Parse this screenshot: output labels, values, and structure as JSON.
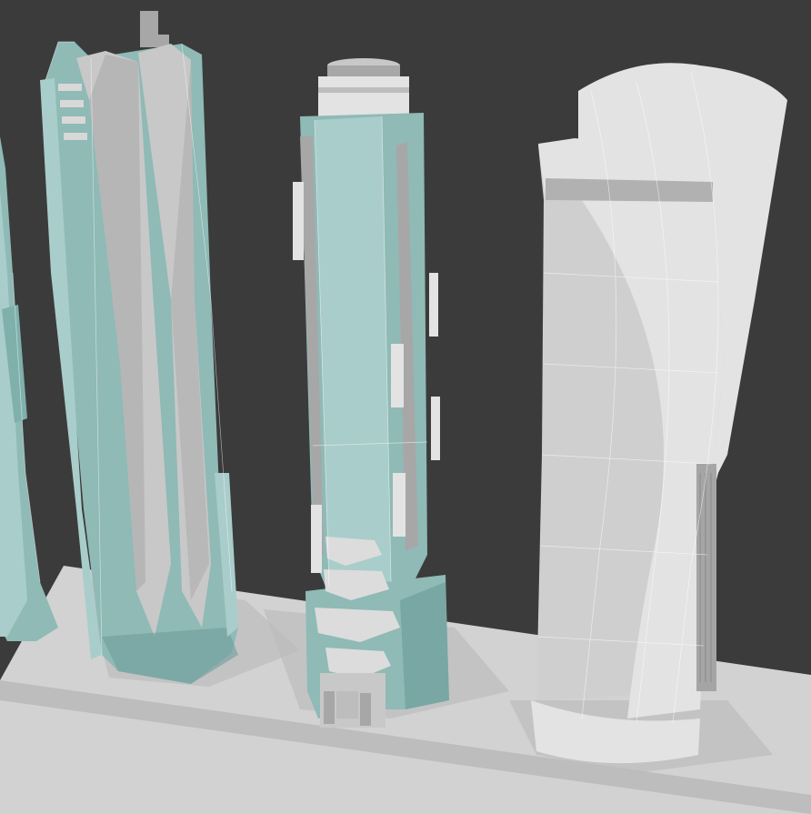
{
  "scene": {
    "background_color": "#3b3b3b",
    "floor_color": "#d2d2d2",
    "floor_edge_color": "#bdbdbd",
    "shadow_color": "#bdbdbd",
    "tower_teal_light": "#a9cdca",
    "tower_teal_mid": "#8fbab6",
    "tower_teal_dark": "#6f9f9b",
    "tower_gray_light": "#c8c8c8",
    "tower_gray_mid": "#a7a7a7",
    "tower_gray_dark": "#7c7c7c",
    "tower_white_light": "#e3e3e3",
    "tower_white_mid": "#cfcfcf",
    "tower_white_dark": "#b1b1b1",
    "wire_color": "#ffffff"
  },
  "objects": [
    {
      "name": "partial-teal-tower-left-edge",
      "material": "teal"
    },
    {
      "name": "tall-teal-tower-with-chevron-fins",
      "material": "teal-gray"
    },
    {
      "name": "cylindrical-teal-tower-with-stacked-base",
      "material": "teal-gray"
    },
    {
      "name": "twisted-white-tower",
      "material": "white"
    }
  ]
}
